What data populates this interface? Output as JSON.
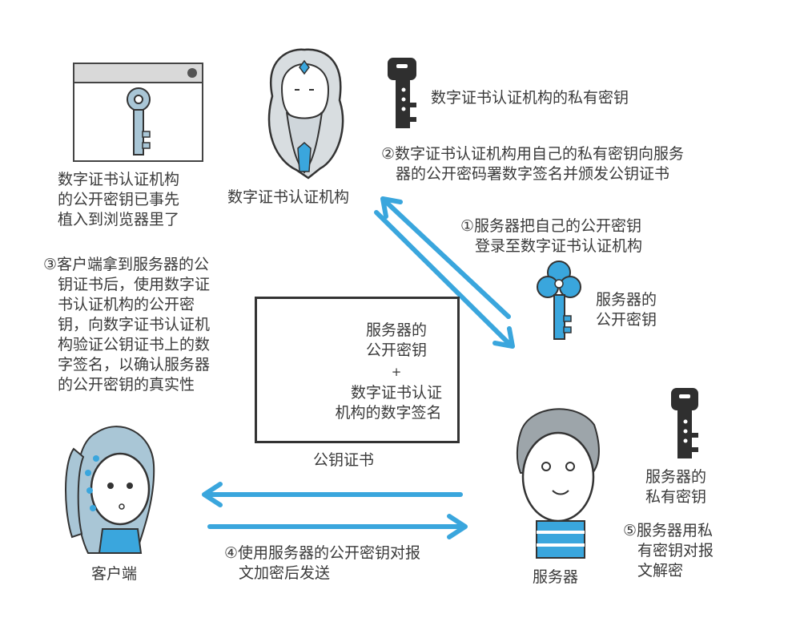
{
  "browser_text": [
    "数字证书认证机构",
    "的公开密钥已事先",
    "植入到浏览器里了"
  ],
  "ca_label": "数字证书认证机构",
  "ca_private_key_label": "数字证书认证机构的私有密钥",
  "step2": [
    "②数字证书认证机构用自己的私有密钥向服务",
    "器的公开密码署数字签名并颁发公钥证书"
  ],
  "step1": [
    "①服务器把自己的公开密钥",
    "登录至数字证书认证机构"
  ],
  "server_public_key_label": [
    "服务器的",
    "公开密钥"
  ],
  "step3": [
    "③客户端拿到服务器的公",
    "钥证书后，使用数字证",
    "书认证机构的公开密",
    "钥，向数字证书认证机",
    "构验证公钥证书上的数",
    "字签名，以确认服务器",
    "的公开密钥的真实性"
  ],
  "certificate": {
    "line1": "服务器的",
    "line2": "公开密钥",
    "plus": "+",
    "line3": "数字证书认证",
    "line4": "机构的数字签名",
    "caption": "公钥证书"
  },
  "server_private_key_label": [
    "服务器的",
    "私有密钥"
  ],
  "step5": [
    "⑤服务器用私",
    "有密钥对报",
    "文解密"
  ],
  "step4": [
    "④使用服务器的公开密钥对报",
    "文加密后发送"
  ],
  "client_label": "客户端",
  "server_label": "服务器",
  "colors": {
    "accent": "#3aa6dd",
    "dark_key": "#2f2f2f",
    "light_key": "#a9c6d6",
    "text": "#3a3a3a"
  }
}
